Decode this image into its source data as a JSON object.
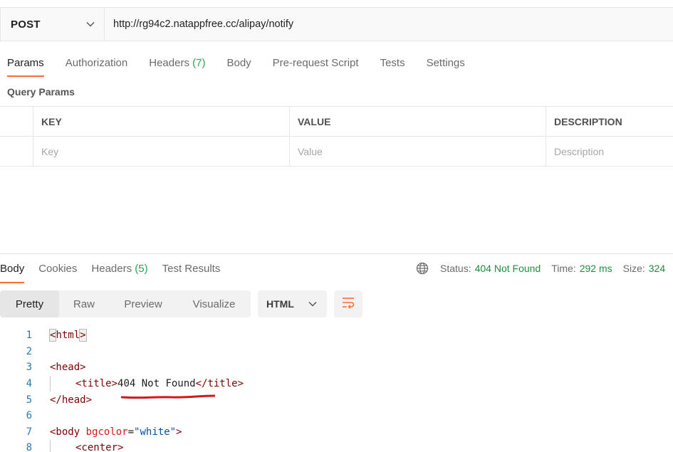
{
  "request": {
    "method": "POST",
    "url": "http://rg94c2.natappfree.cc/alipay/notify"
  },
  "request_tabs": [
    {
      "label": "Params",
      "count": ""
    },
    {
      "label": "Authorization",
      "count": ""
    },
    {
      "label": "Headers",
      "count": "(7)"
    },
    {
      "label": "Body",
      "count": ""
    },
    {
      "label": "Pre-request Script",
      "count": ""
    },
    {
      "label": "Tests",
      "count": ""
    },
    {
      "label": "Settings",
      "count": ""
    }
  ],
  "query_params": {
    "title": "Query Params",
    "headers": {
      "key": "KEY",
      "value": "VALUE",
      "description": "DESCRIPTION"
    },
    "placeholders": {
      "key": "Key",
      "value": "Value",
      "description": "Description"
    }
  },
  "response_tabs": [
    {
      "label": "Body",
      "count": ""
    },
    {
      "label": "Cookies",
      "count": ""
    },
    {
      "label": "Headers",
      "count": "(5)"
    },
    {
      "label": "Test Results",
      "count": ""
    }
  ],
  "status": {
    "status_label": "Status:",
    "status_value": "404 Not Found",
    "time_label": "Time:",
    "time_value": "292 ms",
    "size_label": "Size:",
    "size_value": "324"
  },
  "view_modes": [
    "Pretty",
    "Raw",
    "Preview",
    "Visualize"
  ],
  "format": "HTML",
  "icons": {
    "method_chevron": "chevron-down-icon",
    "globe": "globe-icon",
    "format_chevron": "chevron-down-icon",
    "wrap": "wrap-lines-icon"
  },
  "colors": {
    "accent": "#ff6c37",
    "status_ok": "#1e8e3e",
    "line_number": "#2a7ab0"
  },
  "code": {
    "line_numbers": [
      "1",
      "2",
      "3",
      "4",
      "5",
      "6",
      "7",
      "8"
    ],
    "l1_lt": "<",
    "l1_tag": "html",
    "l1_gt": ">",
    "l3_tag": "<head>",
    "l4_open": "<title>",
    "l4_text": "404 Not Found",
    "l4_close": "</title>",
    "l5_tag": "</head>",
    "l7_tag": "<body",
    "l7_attr": " bgcolor",
    "l7_eq": "=",
    "l7_str": "\"white\"",
    "l7_gt": ">",
    "l8_tag": "<center>"
  }
}
